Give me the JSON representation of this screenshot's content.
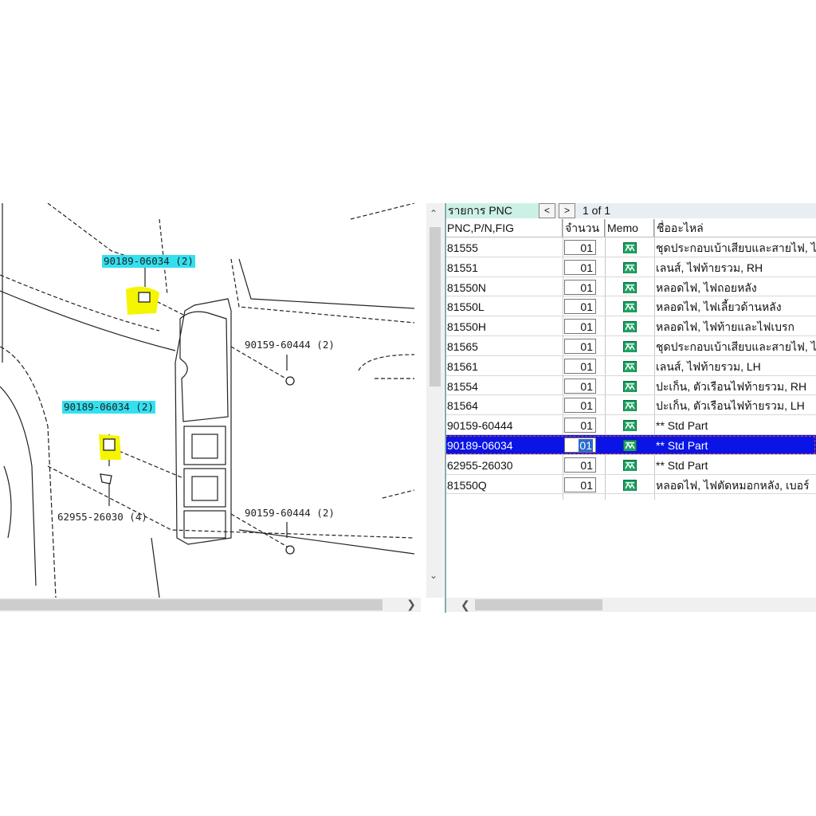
{
  "diagram": {
    "callouts": [
      {
        "text": "90189-06034 (2)",
        "highlighted": true
      },
      {
        "text": "90159-60444 (2)",
        "highlighted": false
      },
      {
        "text": "90189-06034 (2)",
        "highlighted": true
      },
      {
        "text": "62955-26030 (4)",
        "highlighted": false
      },
      {
        "text": "90159-60444 (2)",
        "highlighted": false
      }
    ]
  },
  "pnc_list": {
    "title": "รายการ PNC",
    "prev_label": "<",
    "next_label": ">",
    "page_info": "1 of 1",
    "columns": [
      "PNC,P/N,FIG",
      "จำนวน",
      "Memo",
      "ชื่ออะไหล่"
    ],
    "rows": [
      {
        "pnc": "81555",
        "qty": "01",
        "name": "ชุดประกอบเบ้าเสียบและสายไฟ, ไ"
      },
      {
        "pnc": "81551",
        "qty": "01",
        "name": "เลนส์, ไฟท้ายรวม, RH"
      },
      {
        "pnc": "81550N",
        "qty": "01",
        "name": "หลอดไฟ, ไฟถอยหลัง"
      },
      {
        "pnc": "81550L",
        "qty": "01",
        "name": "หลอดไฟ, ไฟเลี้ยวด้านหลัง"
      },
      {
        "pnc": "81550H",
        "qty": "01",
        "name": "หลอดไฟ, ไฟท้ายและไฟเบรก"
      },
      {
        "pnc": "81565",
        "qty": "01",
        "name": "ชุดประกอบเบ้าเสียบและสายไฟ, ไ"
      },
      {
        "pnc": "81561",
        "qty": "01",
        "name": "เลนส์, ไฟท้ายรวม, LH"
      },
      {
        "pnc": "81554",
        "qty": "01",
        "name": "ปะเก็น, ตัวเรือนไฟท้ายรวม, RH"
      },
      {
        "pnc": "81564",
        "qty": "01",
        "name": "ปะเก็น, ตัวเรือนไฟท้ายรวม, LH"
      },
      {
        "pnc": "90159-60444",
        "qty": "01",
        "name": "** Std Part"
      },
      {
        "pnc": "90189-06034",
        "qty": "01",
        "name": "** Std Part"
      },
      {
        "pnc": "62955-26030",
        "qty": "01",
        "name": "** Std Part"
      },
      {
        "pnc": "81550Q",
        "qty": "01",
        "name": "หลอดไฟ, ไฟตัดหมอกหลัง, เบอร์"
      }
    ],
    "selected_row": "90189-06034"
  },
  "icons": {
    "memo": "memo-icon",
    "scroll_up": "chevron-up-icon",
    "scroll_down": "chevron-down-icon",
    "scroll_left": "chevron-left-icon",
    "scroll_right": "chevron-right-icon"
  },
  "colors": {
    "callout_highlight": "#33e0f0",
    "part_highlight": "#f5f500",
    "selection": "#0a14e6",
    "memo_icon": "#1ea060"
  }
}
